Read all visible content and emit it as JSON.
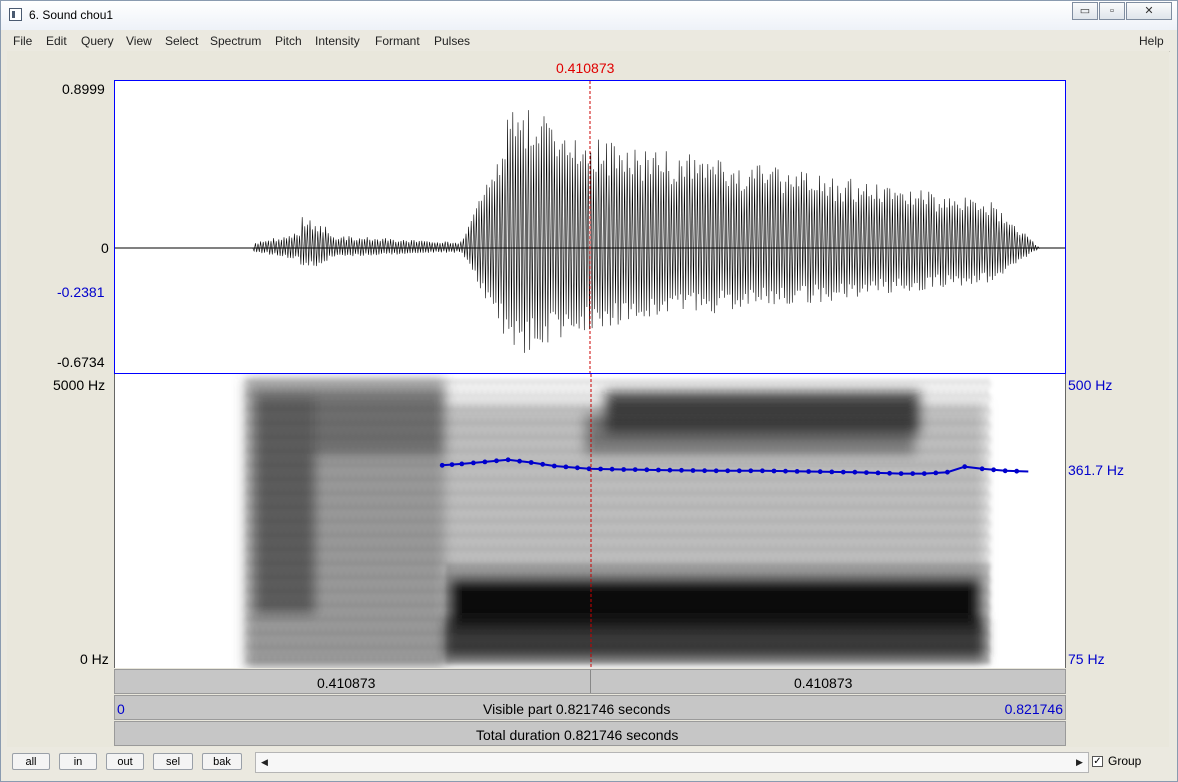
{
  "window": {
    "title": "6. Sound chou1",
    "buttons": [
      "▭",
      "▫",
      "✕"
    ]
  },
  "menu": {
    "items": [
      "File",
      "Edit",
      "Query",
      "View",
      "Select",
      "Spectrum",
      "Pitch",
      "Intensity",
      "Formant",
      "Pulses"
    ],
    "help": "Help"
  },
  "cursor": {
    "time_label": "0.410873",
    "time_s": 0.410873
  },
  "waveform": {
    "ymax_label": "0.8999",
    "zero_label": "0",
    "cursor_value_label": "-0.2381",
    "ymin_label": "-0.6734",
    "ymax": 0.8999,
    "ymin": -0.6734
  },
  "spectrogram": {
    "freq_max_label": "5000 Hz",
    "freq_min_label": "0 Hz"
  },
  "pitch": {
    "top_label": "500 Hz",
    "current_label": "361.7 Hz",
    "bottom_label": "75 Hz",
    "floor_hz": 75,
    "ceiling_hz": 500,
    "contour": [
      {
        "t": 0.283,
        "hz": 368
      },
      {
        "t": 0.3,
        "hz": 370
      },
      {
        "t": 0.32,
        "hz": 373
      },
      {
        "t": 0.34,
        "hz": 376
      },
      {
        "t": 0.36,
        "hz": 372
      },
      {
        "t": 0.38,
        "hz": 367
      },
      {
        "t": 0.41,
        "hz": 363
      },
      {
        "t": 0.44,
        "hz": 362
      },
      {
        "t": 0.48,
        "hz": 361
      },
      {
        "t": 0.52,
        "hz": 360
      },
      {
        "t": 0.56,
        "hz": 360
      },
      {
        "t": 0.6,
        "hz": 359
      },
      {
        "t": 0.64,
        "hz": 358
      },
      {
        "t": 0.68,
        "hz": 356
      },
      {
        "t": 0.7,
        "hz": 356
      },
      {
        "t": 0.72,
        "hz": 358
      },
      {
        "t": 0.735,
        "hz": 366
      },
      {
        "t": 0.75,
        "hz": 363
      },
      {
        "t": 0.77,
        "hz": 360
      },
      {
        "t": 0.79,
        "hz": 359
      }
    ]
  },
  "time_bars": {
    "left_part": "0.410873",
    "right_part": "0.410873",
    "visible_start": "0",
    "visible_text": "Visible part 0.821746 seconds",
    "visible_end": "0.821746",
    "total_text": "Total duration 0.821746 seconds",
    "duration_s": 0.821746
  },
  "buttons": {
    "all": "all",
    "in": "in",
    "out": "out",
    "sel": "sel",
    "bak": "bak"
  },
  "scroll": {
    "left": "◀",
    "right": "▶"
  },
  "group": {
    "label": "Group",
    "checked": true,
    "check": "✓"
  },
  "colors": {
    "cursor": "#cc0000",
    "pitch": "#0000cc",
    "axis_blue": "#0000cc"
  }
}
